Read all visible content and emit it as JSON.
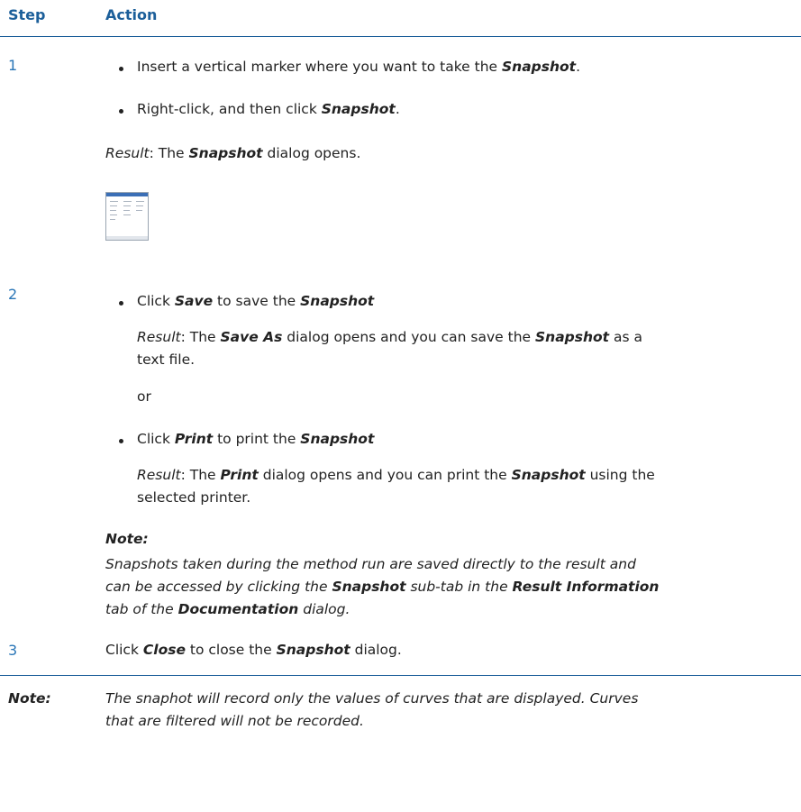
{
  "header": {
    "step": "Step",
    "action": "Action"
  },
  "steps": [
    {
      "num": "1",
      "bullet1": [
        "Insert a vertical marker where you want to take the ",
        "Snapshot",
        "."
      ],
      "bullet2": [
        "Right-click, and then click ",
        "Snapshot",
        "."
      ],
      "result": [
        "Result",
        ": The ",
        "Snapshot",
        " dialog opens."
      ],
      "thumb_icon": "snapshot-dialog-thumbnail"
    },
    {
      "num": "2",
      "save": [
        "Click ",
        "Save",
        " to save the ",
        "Snapshot"
      ],
      "save_result_l1": [
        "Result",
        ": The ",
        "Save As",
        " dialog opens and you can save the ",
        "Snapshot",
        " as a"
      ],
      "save_result_l2": "text file.",
      "or": "or",
      "print": [
        "Click ",
        "Print",
        " to print the ",
        "Snapshot"
      ],
      "print_result_l1": [
        "Result",
        ": The ",
        "Print",
        " dialog opens and you can print the ",
        "Snapshot",
        " using the"
      ],
      "print_result_l2": "selected printer.",
      "note_title": "Note:",
      "note_l1": "Snapshots taken during the method run are saved directly to the result and",
      "note_l2": [
        "can be accessed by clicking the ",
        "Snapshot",
        " sub-tab in the ",
        "Result Information"
      ],
      "note_l3": [
        "tab of the ",
        "Documentation",
        " dialog."
      ]
    },
    {
      "num": "3",
      "close": [
        "Click ",
        "Close",
        " to close the ",
        "Snapshot",
        " dialog."
      ]
    }
  ],
  "footer_note": {
    "label": "Note:",
    "l1": "The snaphot will record only the values of curves that are displayed. Curves",
    "l2": "that are filtered will not be recorded."
  }
}
